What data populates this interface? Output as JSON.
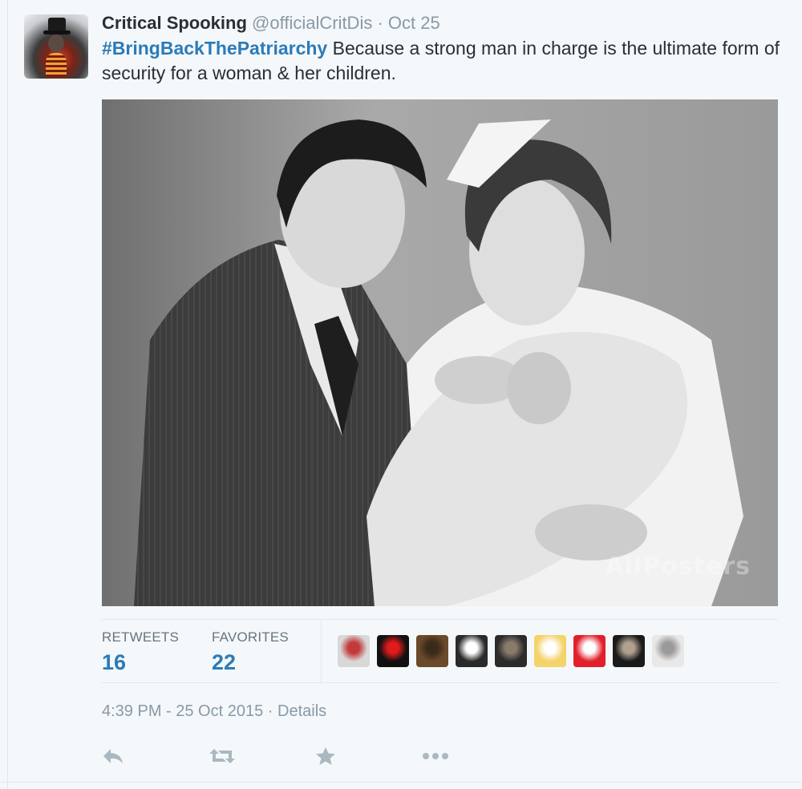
{
  "tweet": {
    "author_name": "Critical Spooking",
    "author_handle": "@officialCritDis",
    "separator": "·",
    "date": "Oct 25",
    "hashtag": "#BringBackThePatriarchy",
    "body": " Because a strong man in charge is the ultimate form of security for a woman & her children.",
    "media_watermark": "AllPosters",
    "timestamp": "4:39 PM - 25 Oct 2015",
    "details_link": "Details"
  },
  "stats": {
    "retweets_label": "RETWEETS",
    "retweets_count": "16",
    "favorites_label": "FAVORITES",
    "favorites_count": "22"
  },
  "favoriters": [
    {
      "icon": "avatar-two-portraits",
      "colors": [
        "#d8d8d8",
        "#c23a3a"
      ]
    },
    {
      "icon": "avatar-red-eye",
      "colors": [
        "#111111",
        "#e01b1b"
      ]
    },
    {
      "icon": "avatar-man-portrait",
      "colors": [
        "#6b4a2a",
        "#3a2a1a"
      ]
    },
    {
      "icon": "avatar-gone-poster",
      "colors": [
        "#2a2a2a",
        "#ffffff"
      ]
    },
    {
      "icon": "avatar-woman-portrait",
      "colors": [
        "#2b2b2b",
        "#8a7a6a"
      ]
    },
    {
      "icon": "avatar-anime-character",
      "colors": [
        "#f3d36a",
        "#ffffff"
      ]
    },
    {
      "icon": "avatar-red-logo",
      "colors": [
        "#e0202a",
        "#ffffff"
      ]
    },
    {
      "icon": "avatar-dark-portrait",
      "colors": [
        "#1a1a1a",
        "#b0a090"
      ]
    },
    {
      "icon": "avatar-statue",
      "colors": [
        "#e8e8e8",
        "#9a9a9a"
      ]
    }
  ],
  "actions": [
    {
      "icon": "reply-icon"
    },
    {
      "icon": "retweet-icon"
    },
    {
      "icon": "favorite-star-icon"
    },
    {
      "icon": "more-dots-icon"
    }
  ],
  "colors": {
    "link_blue": "#2b7bb9",
    "muted": "#8899a6",
    "background": "#f5f8fa"
  }
}
